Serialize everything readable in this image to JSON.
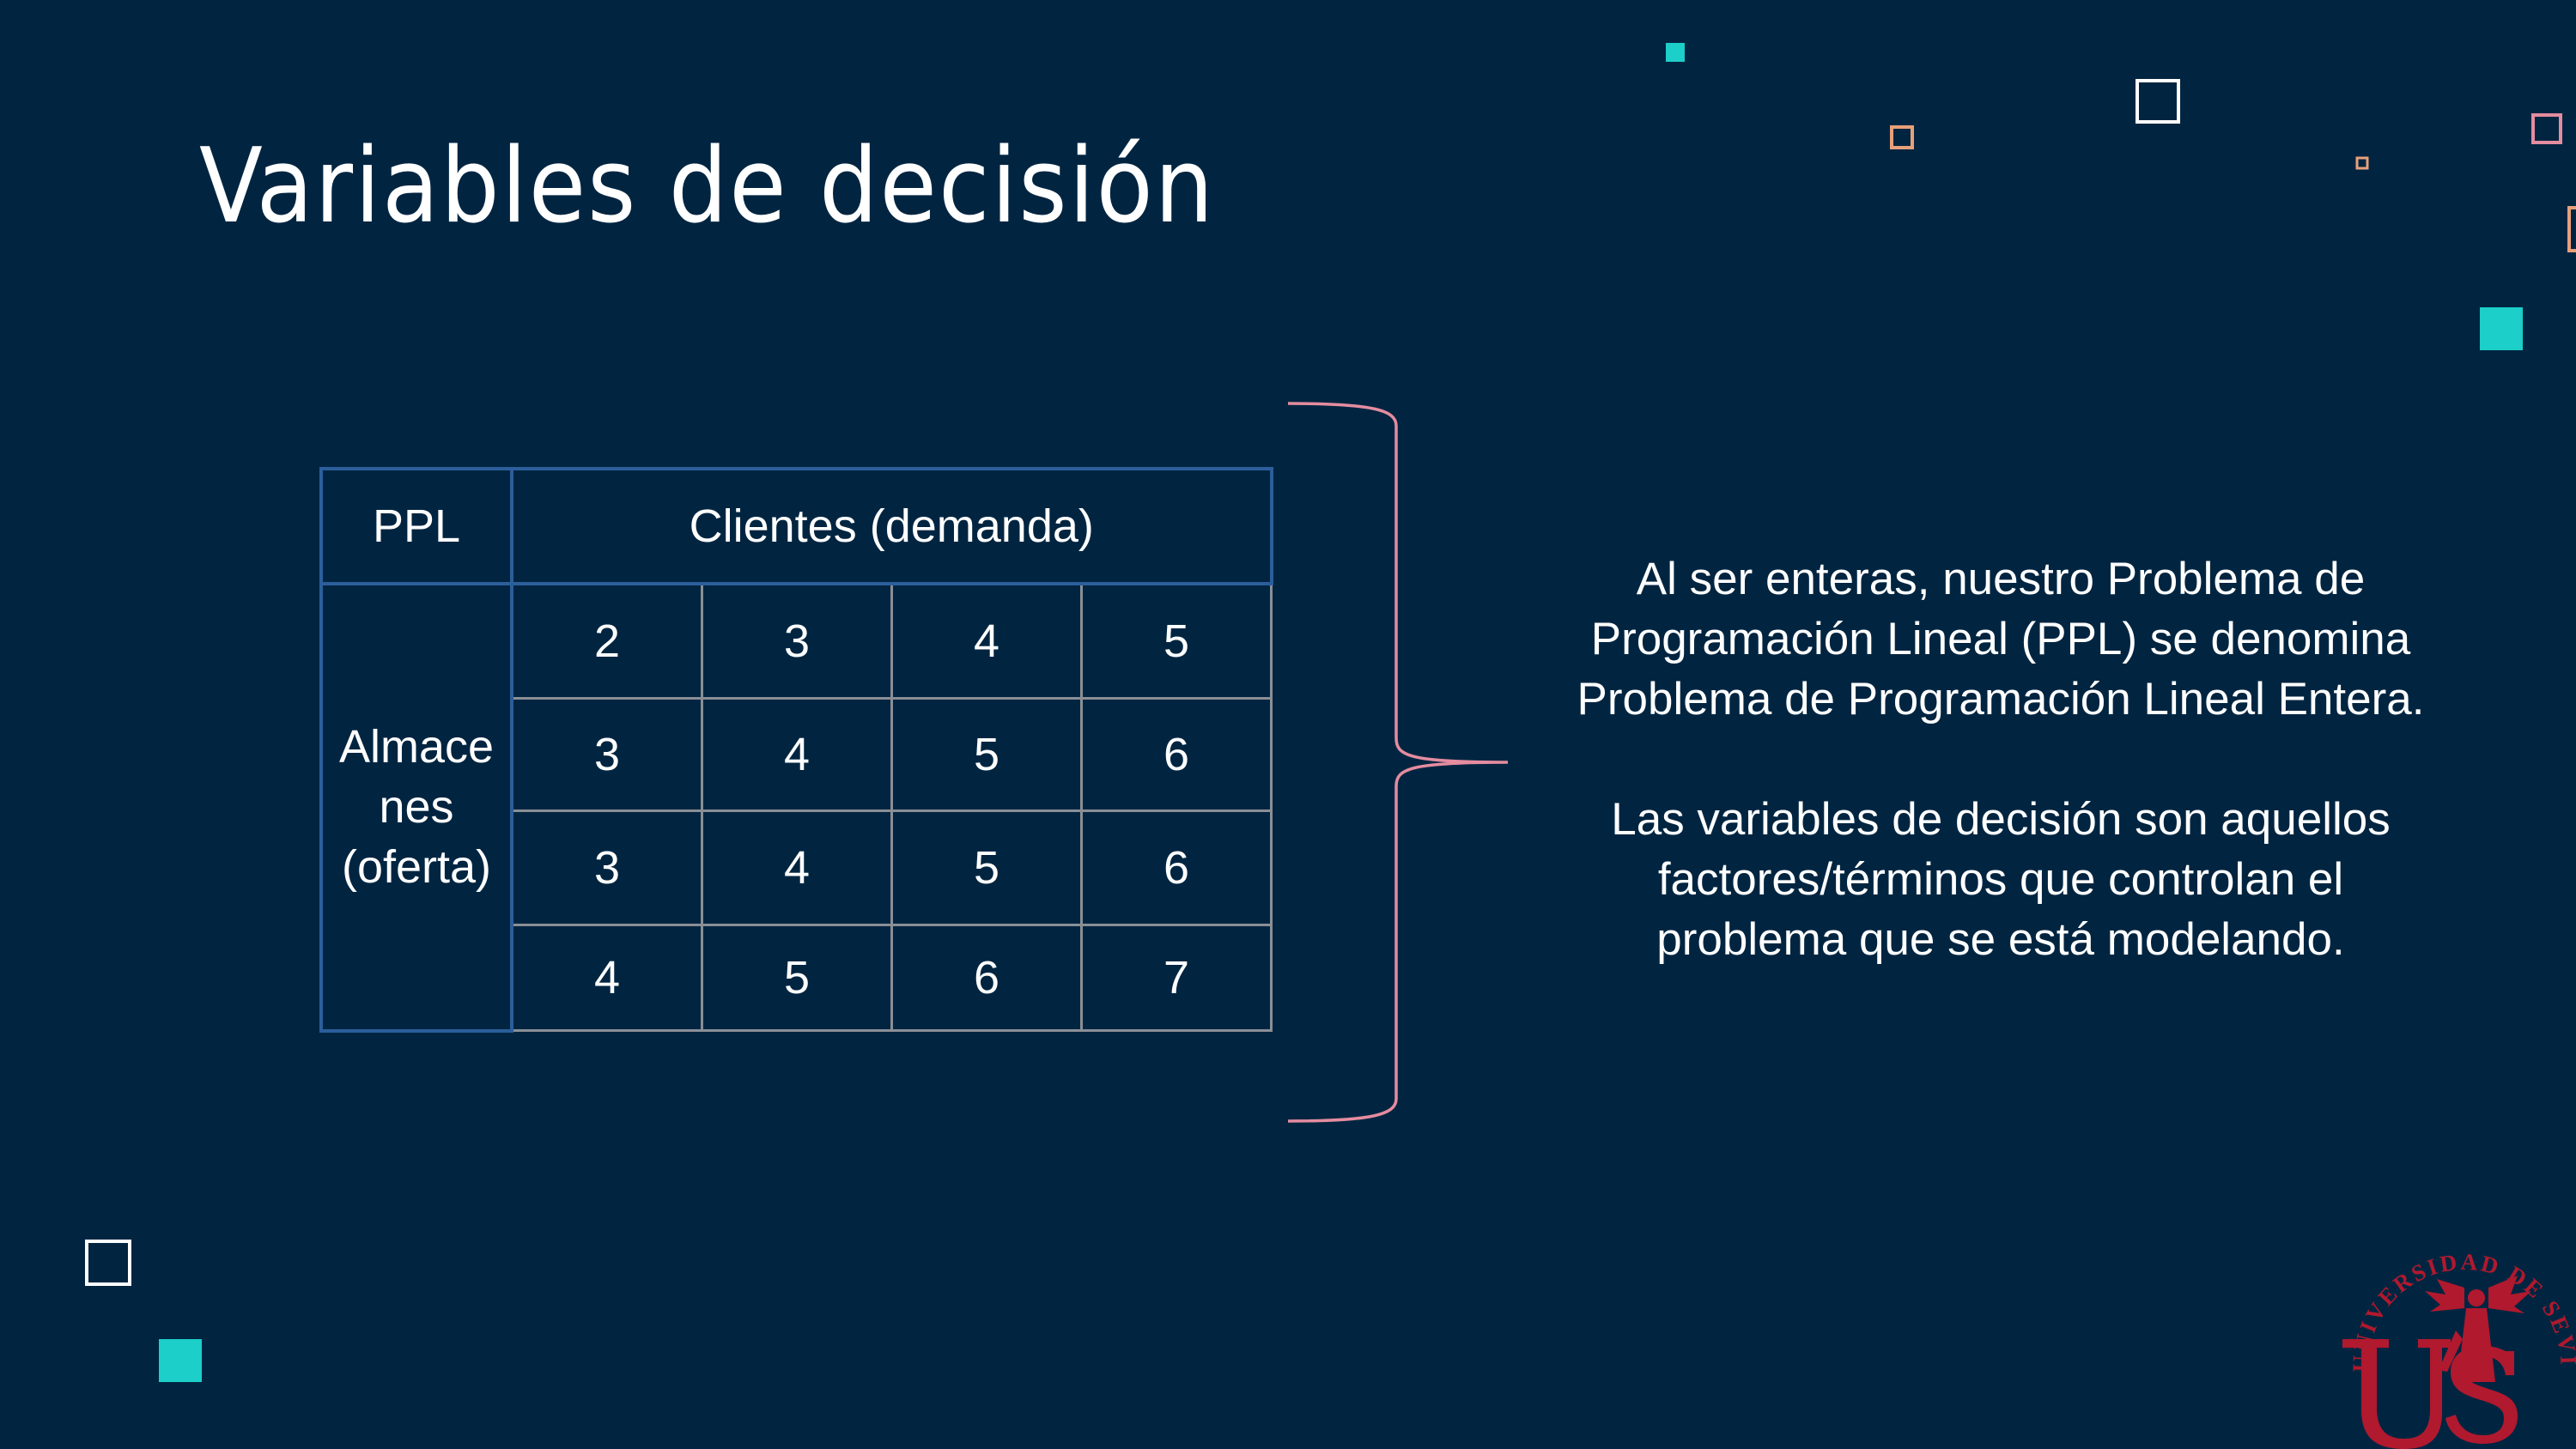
{
  "slide": {
    "title": "Variables de decisión",
    "table": {
      "corner": "PPL",
      "column_header": "Clientes (demanda)",
      "row_header": "Almacenes (oferta)",
      "row_header_lines": [
        "Almace",
        "nes",
        "(oferta)"
      ],
      "rows": [
        [
          "2",
          "3",
          "4",
          "5"
        ],
        [
          "3",
          "4",
          "5",
          "6"
        ],
        [
          "3",
          "4",
          "5",
          "6"
        ],
        [
          "4",
          "5",
          "6",
          "7"
        ]
      ]
    },
    "description": {
      "paragraph1": "Al ser enteras, nuestro Problema de Programación Lineal (PPL) se denomina Problema de Programación Lineal Entera.",
      "paragraph1_lines": [
        "Al ser enteras, nuestro Problema de",
        "Programación Lineal (PPL) se denomina",
        "Problema de Programación Lineal Entera."
      ],
      "paragraph2": "Las variables de decisión son aquellos factores/términos que controlan el problema que se está modelando.",
      "paragraph2_lines": [
        "Las variables de decisión son aquellos",
        "factores/términos que controlan el",
        "problema que se está modelando."
      ]
    },
    "logo": {
      "text": "UNIVERSIDAD DE SEVILLA",
      "monogram": "us",
      "color": "#b0192e"
    },
    "colors": {
      "background": "#012541",
      "teal": "#1ccfc9",
      "orange": "#e8a07a",
      "pink": "#e58ca0",
      "table_blue": "#2b5e9a"
    }
  }
}
